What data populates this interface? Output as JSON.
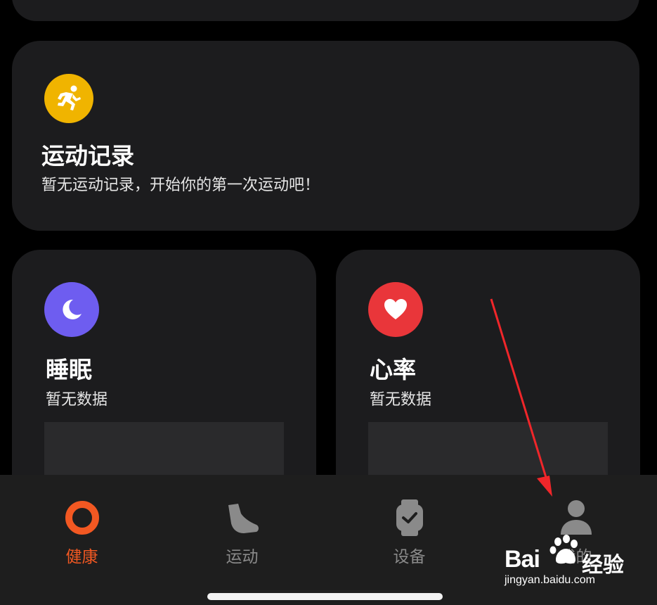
{
  "cards": {
    "workout": {
      "title": "运动记录",
      "subtitle": "暂无运动记录，开始你的第一次运动吧！",
      "icon": "running-icon",
      "color": "#f0b400"
    },
    "sleep": {
      "title": "睡眠",
      "subtitle": "暂无数据",
      "icon": "moon-icon",
      "color": "#6e5df0"
    },
    "heart": {
      "title": "心率",
      "subtitle": "暂无数据",
      "icon": "heart-icon",
      "color": "#e9363a"
    }
  },
  "tabbar": {
    "items": [
      {
        "label": "健康",
        "icon": "ring-icon",
        "active": true,
        "color": "#f25822"
      },
      {
        "label": "运动",
        "icon": "shoe-icon",
        "active": false
      },
      {
        "label": "设备",
        "icon": "watch-icon",
        "active": false
      },
      {
        "label": "我的",
        "icon": "person-icon",
        "active": false
      }
    ]
  },
  "watermark": {
    "brand": "Bai",
    "cn": "经验",
    "url": "jingyan.baidu.com"
  }
}
